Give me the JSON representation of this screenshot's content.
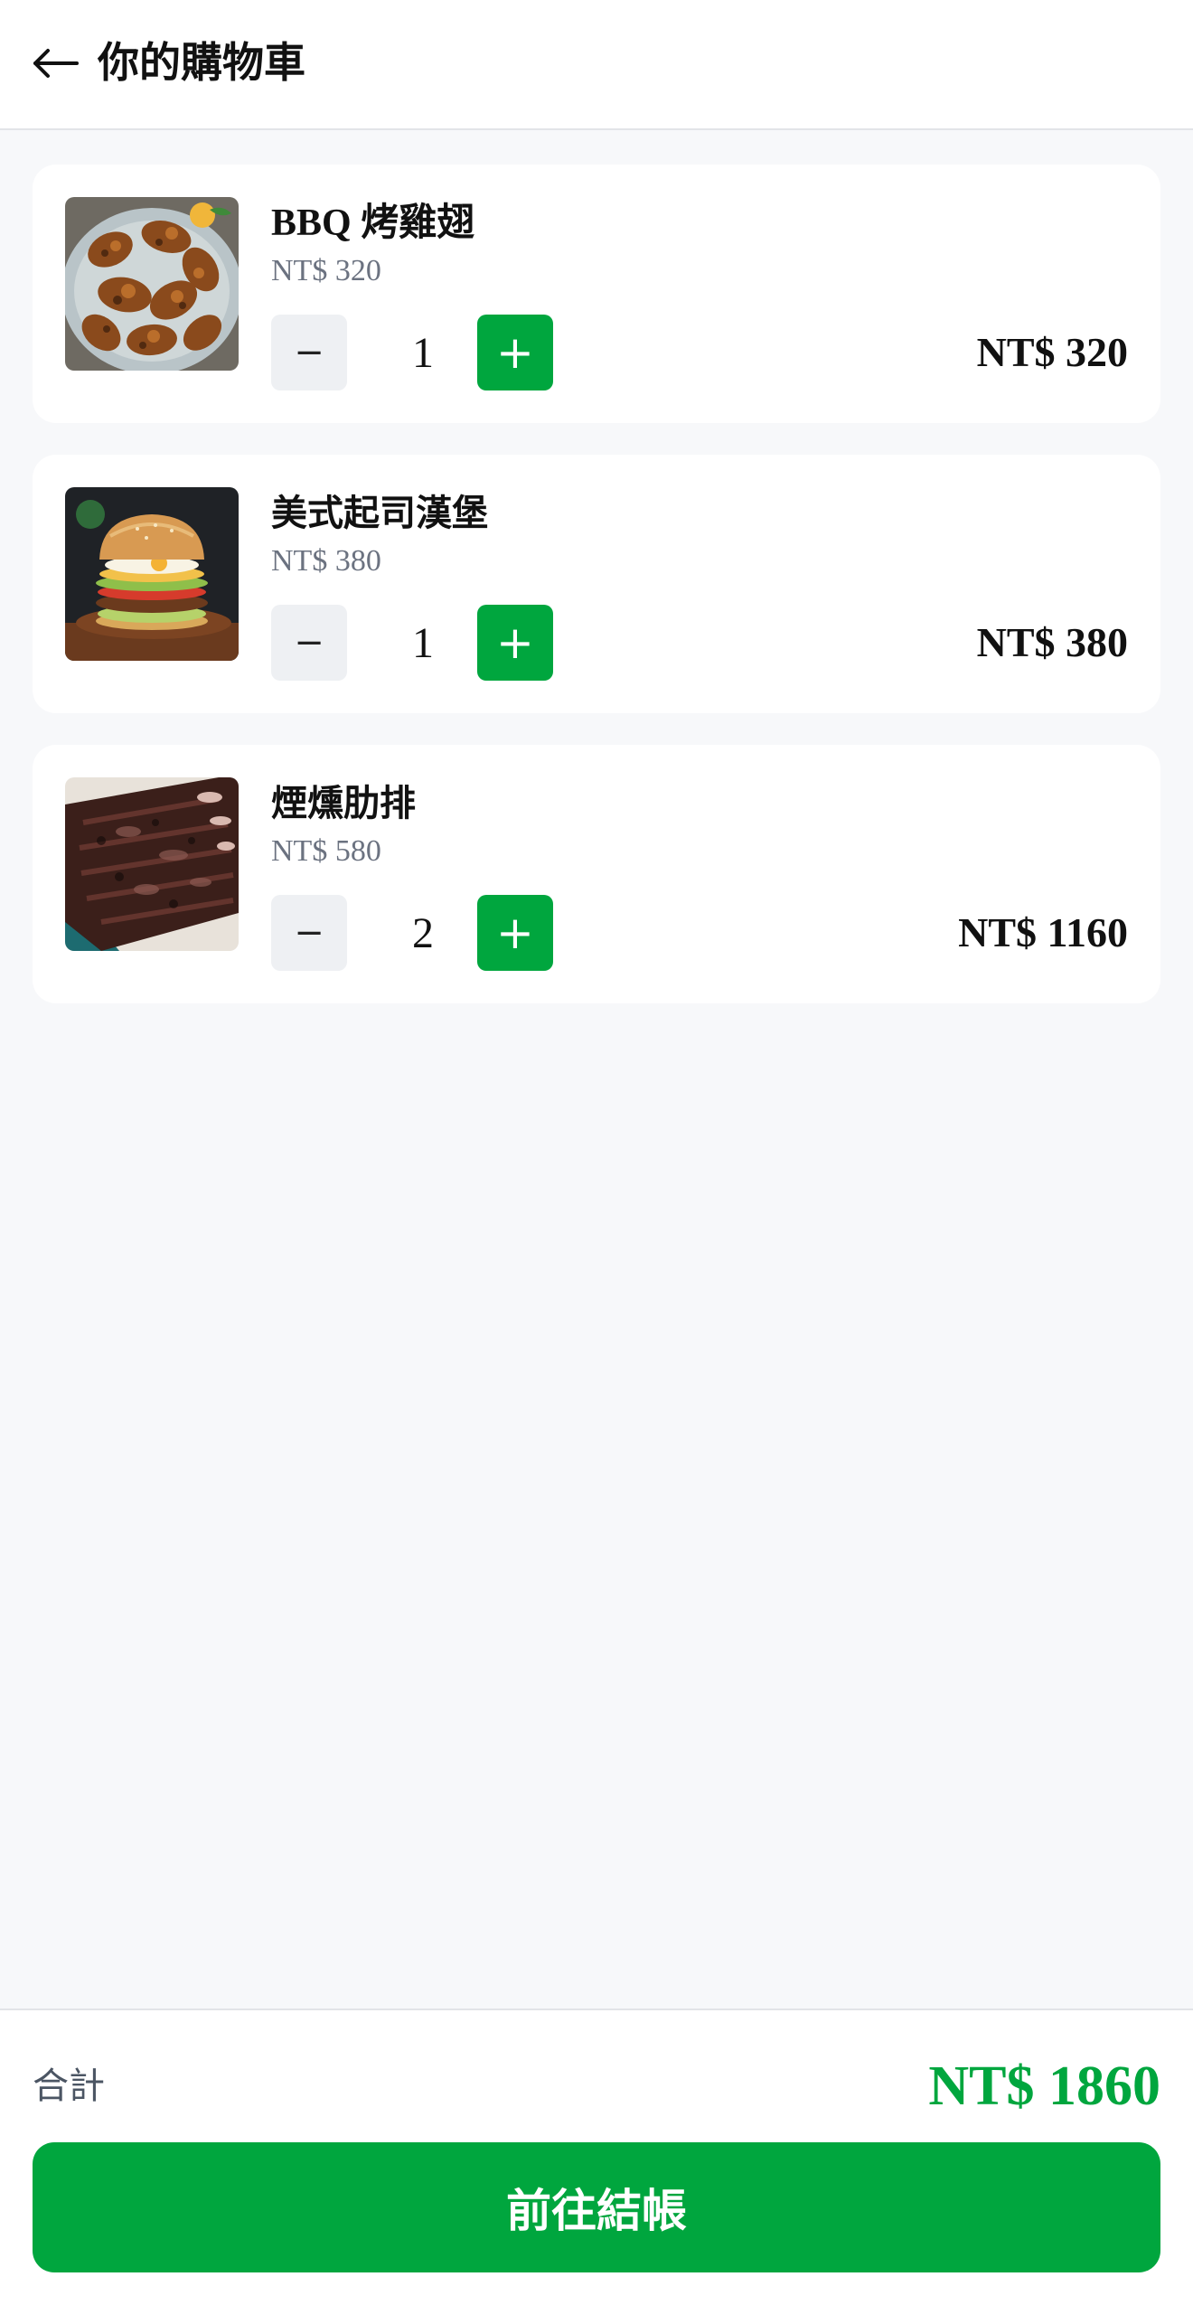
{
  "header": {
    "back_icon": "arrow-left-icon",
    "title": "你的購物車"
  },
  "cart": {
    "items": [
      {
        "name": "BBQ 烤雞翅",
        "image": "bbq-chicken-wings-photo",
        "unit_price": "NT$ 320",
        "minus_label": "−",
        "quantity": "1",
        "plus_label": "+",
        "line_total": "NT$ 320"
      },
      {
        "name": "美式起司漢堡",
        "image": "cheeseburger-photo",
        "unit_price": "NT$ 380",
        "minus_label": "−",
        "quantity": "1",
        "plus_label": "+",
        "line_total": "NT$ 380"
      },
      {
        "name": "煙燻肋排",
        "image": "smoked-ribs-photo",
        "unit_price": "NT$ 580",
        "minus_label": "−",
        "quantity": "2",
        "plus_label": "+",
        "line_total": "NT$ 1160"
      }
    ]
  },
  "footer": {
    "total_label": "合計",
    "total_value": "NT$ 1860",
    "checkout_label": "前往結帳"
  },
  "colors": {
    "accent_green": "#00a63e",
    "background": "#f7f8fa",
    "card": "#ffffff",
    "muted_text": "#6b7280"
  }
}
